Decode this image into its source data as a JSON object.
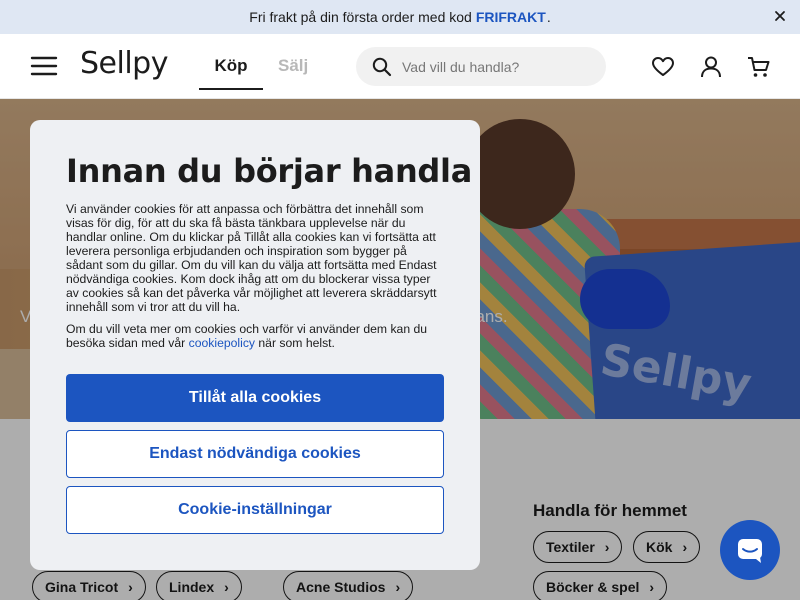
{
  "promo": {
    "text": "Fri frakt på din första order med kod",
    "code": "FRIFRAKT",
    "suffix": "."
  },
  "header": {
    "logo": "Sellpy",
    "tab_buy": "Köp",
    "tab_sell": "Sälj",
    "search_placeholder": "Vad vill du handla?"
  },
  "hero": {
    "left_text": "V",
    "right_text": "hans.",
    "bag_text": "Sellpy"
  },
  "cookie_modal": {
    "title": "Innan du börjar handla",
    "paragraph1": "Vi använder cookies för att anpassa och förbättra det innehåll som visas för dig, för att du ska få bästa tänkbara upplevelse när du handlar online. Om du klickar på Tillåt alla cookies kan vi fortsätta att leverera personliga erbjudanden och inspiration som bygger på sådant som du gillar. Om du vill kan du välja att fortsätta med Endast nödvändiga cookies. Kom dock ihåg att om du blockerar vissa typer av cookies så kan det påverka vår möjlighet att leverera skräddarsytt innehåll som vi tror att du vill ha.",
    "paragraph2_pre": "Om du vill veta mer om cookies och varför vi använder dem kan du besöka sidan med vår",
    "paragraph2_link": "cookiepolicy",
    "paragraph2_post": "när som helst.",
    "btn_allow_all": "Tillåt alla cookies",
    "btn_necessary": "Endast nödvändiga cookies",
    "btn_settings": "Cookie-inställningar"
  },
  "home_section": {
    "title": "Handla för hemmet",
    "chips": [
      "Textiler",
      "Kök",
      "Böcker & spel"
    ]
  },
  "brand_chips": [
    "Gina Tricot",
    "Lindex",
    "Acne Studios"
  ],
  "colors": {
    "accent": "#1c55c0",
    "promo_bg": "#dfe7f3",
    "modal_bg": "#eef0f3"
  }
}
